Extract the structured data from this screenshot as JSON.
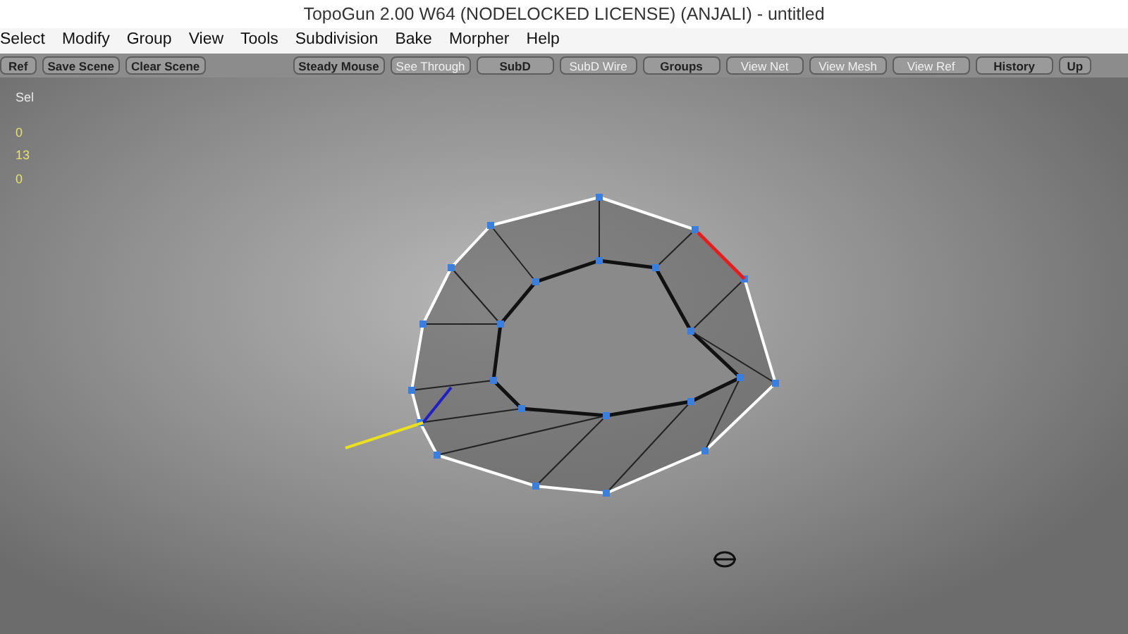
{
  "window": {
    "title": "TopoGun 2.00 W64  (NODELOCKED LICENSE) (ANJALI) - untitled"
  },
  "menu": [
    "Select",
    "Modify",
    "Group",
    "View",
    "Tools",
    "Subdivision",
    "Bake",
    "Morpher",
    "Help"
  ],
  "toolbar_left": [
    {
      "label": "Ref",
      "active": false
    },
    {
      "label": "Save Scene",
      "active": false
    },
    {
      "label": "Clear Scene",
      "active": false
    }
  ],
  "toolbar_right": [
    {
      "label": "Steady Mouse",
      "active": false
    },
    {
      "label": "See Through",
      "active": true
    },
    {
      "label": "SubD",
      "active": false
    },
    {
      "label": "SubD Wire",
      "active": true
    },
    {
      "label": "Groups",
      "active": false
    },
    {
      "label": "View Net",
      "active": true
    },
    {
      "label": "View Mesh",
      "active": true
    },
    {
      "label": "View Ref",
      "active": true
    },
    {
      "label": "History",
      "active": false
    },
    {
      "label": "Up",
      "active": false
    }
  ],
  "stats": {
    "label": "Sel",
    "values": [
      "0",
      "13",
      "0"
    ]
  }
}
